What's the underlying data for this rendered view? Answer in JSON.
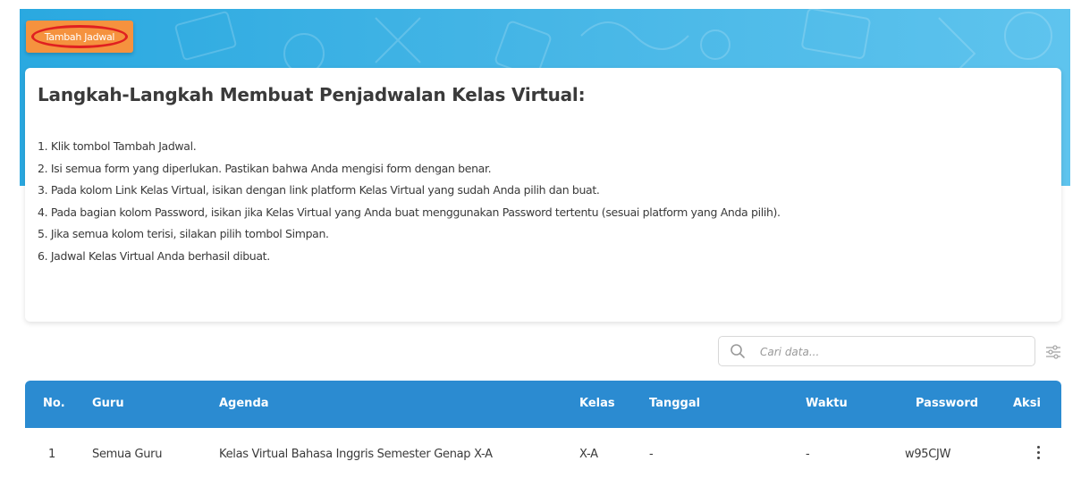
{
  "colors": {
    "banner": "#46b6e6",
    "button": "#f5923e",
    "highlight_ring": "#e02020",
    "table_header": "#2b8bd1"
  },
  "toolbar": {
    "add_label": "Tambah Jadwal"
  },
  "guide": {
    "title": "Langkah-Langkah Membuat Penjadwalan Kelas Virtual:",
    "steps": [
      "1. Klik tombol Tambah Jadwal.",
      "2. Isi semua form yang diperlukan. Pastikan bahwa Anda mengisi form dengan benar.",
      "3. Pada kolom Link Kelas Virtual, isikan dengan link platform Kelas Virtual yang sudah Anda pilih dan buat.",
      "4. Pada bagian kolom Password, isikan jika Kelas Virtual yang Anda buat menggunakan Password tertentu (sesuai platform yang Anda pilih).",
      "5. Jika semua kolom terisi, silakan pilih tombol Simpan.",
      "6. Jadwal Kelas Virtual Anda berhasil dibuat."
    ]
  },
  "search": {
    "placeholder": "Cari data...",
    "value": "",
    "icon": "search-icon",
    "filter_icon": "sliders-icon"
  },
  "table": {
    "headers": {
      "no": "No.",
      "guru": "Guru",
      "agenda": "Agenda",
      "kelas": "Kelas",
      "tanggal": "Tanggal",
      "waktu": "Waktu",
      "password": "Password",
      "aksi": "Aksi"
    },
    "rows": [
      {
        "no": "1",
        "guru": "Semua Guru",
        "agenda": "Kelas Virtual Bahasa Inggris Semester Genap X-A",
        "kelas": "X-A",
        "tanggal": "-",
        "waktu": "-",
        "password": "w95CJW",
        "aksi_icon": "kebab-menu-icon"
      }
    ]
  }
}
